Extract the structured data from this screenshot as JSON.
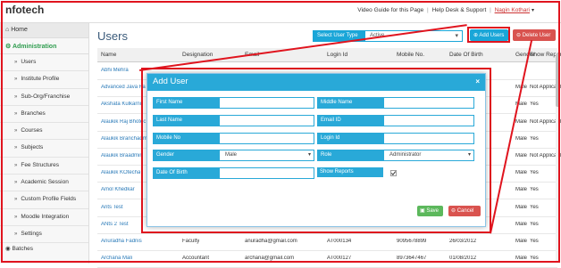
{
  "app": {
    "brand": "nfotech"
  },
  "topbar": {
    "video_guide": "Video Guide for this Page",
    "help": "Help Desk & Support",
    "user": "Nagin Kothari",
    "caret": "▾",
    "sep": "|"
  },
  "sidebar": {
    "home": "Home",
    "section": "Administration",
    "chev": "»",
    "items": [
      "Users",
      "Institute Profile",
      "Sub-Org/Franchise",
      "Branches",
      "Courses",
      "Subjects",
      "Fee Structures",
      "Academic Session",
      "Custom Profile Fields",
      "Moodle Integration",
      "Settings"
    ],
    "bottom": "Batches"
  },
  "main": {
    "title": "Users",
    "user_type_label": "Select User Type",
    "user_type_value": "Active",
    "caret": "▾",
    "add_users": "Add Users",
    "delete_user": "Delete User"
  },
  "table": {
    "headers": [
      "Name",
      "Designation",
      "Email",
      "Login Id",
      "Mobile No.",
      "Date Of Birth",
      "Gender",
      "Show Reports"
    ],
    "rows": [
      [
        "Abhi Mehra",
        "",
        "",
        "",
        "",
        "",
        "",
        ""
      ],
      [
        "Advanced Java Fa",
        "",
        "",
        "",
        "",
        "",
        "Male",
        "Not Applicable"
      ],
      [
        "Akshata Kulkarni",
        "",
        "",
        "",
        "",
        "",
        "Male",
        "Yes"
      ],
      [
        "Alaukik Raj Bhotec",
        "",
        "",
        "",
        "",
        "",
        "Male",
        "Not Applicable"
      ],
      [
        "Alaukik Branchadm",
        "",
        "",
        "",
        "",
        "",
        "Male",
        "Yes"
      ],
      [
        "Alaukik Braadmin",
        "",
        "",
        "",
        "",
        "",
        "Male",
        "Not Applicable"
      ],
      [
        "Alaukik KOtecha",
        "",
        "",
        "",
        "",
        "",
        "Male",
        "Yes"
      ],
      [
        "Amol Khedkar",
        "",
        "",
        "",
        "",
        "",
        "Male",
        "Yes"
      ],
      [
        "Arits Test",
        "",
        "",
        "",
        "",
        "",
        "Male",
        "Yes"
      ],
      [
        "ANts 2 Test",
        "",
        "",
        "",
        "",
        "",
        "Male",
        "Yes"
      ],
      [
        "Anuradha Fadnis",
        "Faculty",
        "anuradha@gmail.com",
        "AT000134",
        "9095678899",
        "26/03/2012",
        "Male",
        "Yes"
      ],
      [
        "Archana Mali",
        "Accountant",
        "archana@gmail.com",
        "AT000127",
        "8973647467",
        "01/08/2012",
        "Male",
        "Yes"
      ]
    ]
  },
  "modal": {
    "title": "Add User",
    "close": "×",
    "fields": {
      "first_name": "First Name",
      "middle_name": "Middle Name",
      "last_name": "Last Name",
      "email_id": "Email ID",
      "mobile_no": "Mobile No",
      "login_id": "Login Id",
      "gender": "Gender",
      "gender_value": "Male",
      "role": "Role",
      "role_value": "Administrator",
      "dob": "Date Of Birth",
      "show_reports": "Show Reports"
    },
    "show_reports_checked": true,
    "save": "Save",
    "cancel": "Cancel"
  },
  "colors": {
    "accent": "#29a9d8",
    "danger": "#d9534f",
    "success": "#5cb85c",
    "annotation": "#e0141e"
  }
}
